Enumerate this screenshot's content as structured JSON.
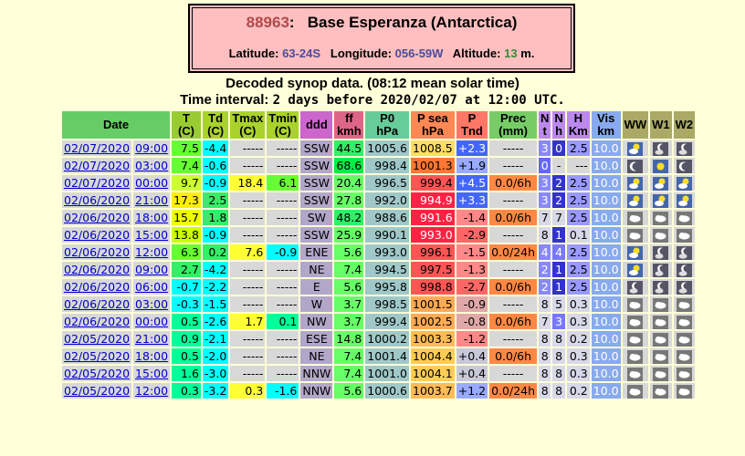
{
  "station": {
    "id": "88963",
    "name": "Base Esperanza (Antarctica)",
    "latitude_label": "Latitude:",
    "latitude": "63-24S",
    "longitude_label": "Longitude:",
    "longitude": "056-59W",
    "altitude_label": "Altitude:",
    "altitude": "13",
    "altitude_unit": "m."
  },
  "heading": {
    "line1": "Decoded synop data. (08:12 mean solar time)",
    "line2_prefix": "Time interval:",
    "line2_mono": "2 days before 2020/02/07 at 12:00 UTC."
  },
  "table": {
    "headers": [
      {
        "l1": "Date",
        "l2": ""
      },
      {
        "l1": "T",
        "l2": "(C)"
      },
      {
        "l1": "Td",
        "l2": "(C)"
      },
      {
        "l1": "Tmax",
        "l2": "(C)"
      },
      {
        "l1": "Tmin",
        "l2": "(C)"
      },
      {
        "l1": "ddd",
        "l2": ""
      },
      {
        "l1": "ff",
        "l2": "kmh"
      },
      {
        "l1": "P0",
        "l2": "hPa"
      },
      {
        "l1": "P sea",
        "l2": "hPa"
      },
      {
        "l1": "P",
        "l2": "Tnd"
      },
      {
        "l1": "Prec",
        "l2": "(mm)"
      },
      {
        "l1": "N",
        "l2": "t"
      },
      {
        "l1": "N",
        "l2": "h"
      },
      {
        "l1": "H",
        "l2": "Km"
      },
      {
        "l1": "Vis",
        "l2": "km"
      },
      {
        "l1": "WW",
        "l2": ""
      },
      {
        "l1": "W1",
        "l2": ""
      },
      {
        "l1": "W2",
        "l2": ""
      }
    ],
    "rows": [
      {
        "date": "02/07/2020",
        "time": "09:00",
        "t": "7.5",
        "td": "-4.4",
        "tmax": "-----",
        "tmin": "-----",
        "ddd": "SSW",
        "ff": "44.5",
        "p0": "1005.6",
        "psea": "1008.5",
        "ptnd": "+2.3",
        "prec": "-----",
        "nt": "3",
        "nh": "0",
        "h": "2.5",
        "vis": "10.0",
        "ww": "sun-cloud",
        "w1": "moon-cloud",
        "w2": "moon-cloud"
      },
      {
        "date": "02/07/2020",
        "time": "03:00",
        "t": "7.4",
        "td": "-0.6",
        "tmax": "-----",
        "tmin": "-----",
        "ddd": "SSW",
        "ff": "68.6",
        "p0": "998.4",
        "psea": "1001.3",
        "ptnd": "+1.9",
        "prec": "-----",
        "nt": "0",
        "nh": "-",
        "h": "---",
        "vis": "10.0",
        "ww": "moon",
        "w1": "sun",
        "w2": "moon"
      },
      {
        "date": "02/07/2020",
        "time": "00:00",
        "t": "9.7",
        "td": "-0.9",
        "tmax": "18.4",
        "tmin": "6.1",
        "ddd": "SSW",
        "ff": "20.4",
        "p0": "996.5",
        "psea": "999.4",
        "ptnd": "+4.5",
        "prec": "0.0/6h",
        "nt": "3",
        "nh": "2",
        "h": "2.5",
        "vis": "10.0",
        "ww": "sun-cloud",
        "w1": "sun-cloud",
        "w2": "sun-cloud"
      },
      {
        "date": "02/06/2020",
        "time": "21:00",
        "t": "17.3",
        "td": "2.5",
        "tmax": "-----",
        "tmin": "-----",
        "ddd": "SSW",
        "ff": "27.8",
        "p0": "992.0",
        "psea": "994.9",
        "ptnd": "+3.3",
        "prec": "-----",
        "nt": "3",
        "nh": "2",
        "h": "2.5",
        "vis": "10.0",
        "ww": "sun-cloud",
        "w1": "sun-cloud",
        "w2": "sun-cloud"
      },
      {
        "date": "02/06/2020",
        "time": "18:00",
        "t": "15.7",
        "td": "1.8",
        "tmax": "-----",
        "tmin": "-----",
        "ddd": "SW",
        "ff": "48.2",
        "p0": "988.6",
        "psea": "991.6",
        "ptnd": "-1.4",
        "prec": "0.0/6h",
        "nt": "7",
        "nh": "7",
        "h": "2.5",
        "vis": "10.0",
        "ww": "cloud",
        "w1": "cloud",
        "w2": "cloud"
      },
      {
        "date": "02/06/2020",
        "time": "15:00",
        "t": "13.8",
        "td": "-0.9",
        "tmax": "-----",
        "tmin": "-----",
        "ddd": "SSW",
        "ff": "25.9",
        "p0": "990.1",
        "psea": "993.0",
        "ptnd": "-2.9",
        "prec": "-----",
        "nt": "8",
        "nh": "1",
        "h": "0.1",
        "vis": "10.0",
        "ww": "cloud",
        "w1": "cloud",
        "w2": "cloud"
      },
      {
        "date": "02/06/2020",
        "time": "12:00",
        "t": "6.3",
        "td": "0.2",
        "tmax": "7.6",
        "tmin": "-0.9",
        "ddd": "ENE",
        "ff": "5.6",
        "p0": "993.0",
        "psea": "996.1",
        "ptnd": "-1.5",
        "prec": "0.0/24h",
        "nt": "4",
        "nh": "4",
        "h": "2.5",
        "vis": "10.0",
        "ww": "sun-cloud",
        "w1": "moon-cloud",
        "w2": "moon-cloud"
      },
      {
        "date": "02/06/2020",
        "time": "09:00",
        "t": "2.7",
        "td": "-4.2",
        "tmax": "-----",
        "tmin": "-----",
        "ddd": "NE",
        "ff": "7.4",
        "p0": "994.5",
        "psea": "997.5",
        "ptnd": "-1.3",
        "prec": "-----",
        "nt": "2",
        "nh": "1",
        "h": "2.5",
        "vis": "10.0",
        "ww": "sun-cloud",
        "w1": "moon-cloud",
        "w2": "moon-cloud"
      },
      {
        "date": "02/06/2020",
        "time": "06:00",
        "t": "-0.7",
        "td": "-2.2",
        "tmax": "-----",
        "tmin": "-----",
        "ddd": "E",
        "ff": "5.6",
        "p0": "995.8",
        "psea": "998.8",
        "ptnd": "-2.7",
        "prec": "0.0/6h",
        "nt": "2",
        "nh": "1",
        "h": "2.5",
        "vis": "10.0",
        "ww": "moon-cloud",
        "w1": "moon-cloud",
        "w2": "moon-cloud"
      },
      {
        "date": "02/06/2020",
        "time": "03:00",
        "t": "-0.3",
        "td": "-1.5",
        "tmax": "-----",
        "tmin": "-----",
        "ddd": "W",
        "ff": "3.7",
        "p0": "998.5",
        "psea": "1001.5",
        "ptnd": "-0.9",
        "prec": "-----",
        "nt": "8",
        "nh": "5",
        "h": "0.3",
        "vis": "10.0",
        "ww": "cloud",
        "w1": "cloud",
        "w2": "cloud"
      },
      {
        "date": "02/06/2020",
        "time": "00:00",
        "t": "0.5",
        "td": "-2.6",
        "tmax": "1.7",
        "tmin": "0.1",
        "ddd": "NW",
        "ff": "3.7",
        "p0": "999.4",
        "psea": "1002.5",
        "ptnd": "-0.8",
        "prec": "0.0/6h",
        "nt": "7",
        "nh": "3",
        "h": "0.3",
        "vis": "10.0",
        "ww": "cloud",
        "w1": "cloud",
        "w2": "cloud"
      },
      {
        "date": "02/05/2020",
        "time": "21:00",
        "t": "0.9",
        "td": "-2.1",
        "tmax": "-----",
        "tmin": "-----",
        "ddd": "ESE",
        "ff": "14.8",
        "p0": "1000.2",
        "psea": "1003.3",
        "ptnd": "-1.2",
        "prec": "-----",
        "nt": "8",
        "nh": "8",
        "h": "0.2",
        "vis": "10.0",
        "ww": "cloud",
        "w1": "cloud",
        "w2": "cloud"
      },
      {
        "date": "02/05/2020",
        "time": "18:00",
        "t": "0.5",
        "td": "-2.0",
        "tmax": "-----",
        "tmin": "-----",
        "ddd": "NE",
        "ff": "7.4",
        "p0": "1001.4",
        "psea": "1004.4",
        "ptnd": "+0.4",
        "prec": "0.0/6h",
        "nt": "8",
        "nh": "8",
        "h": "0.3",
        "vis": "10.0",
        "ww": "cloud",
        "w1": "cloud",
        "w2": "cloud"
      },
      {
        "date": "02/05/2020",
        "time": "15:00",
        "t": "1.6",
        "td": "-3.0",
        "tmax": "-----",
        "tmin": "-----",
        "ddd": "NNW",
        "ff": "7.4",
        "p0": "1001.0",
        "psea": "1004.1",
        "ptnd": "+0.4",
        "prec": "-----",
        "nt": "8",
        "nh": "8",
        "h": "0.3",
        "vis": "10.0",
        "ww": "cloud",
        "w1": "cloud",
        "w2": "cloud"
      },
      {
        "date": "02/05/2020",
        "time": "12:00",
        "t": "0.3",
        "td": "-3.2",
        "tmax": "0.3",
        "tmin": "-1.6",
        "ddd": "NNW",
        "ff": "5.6",
        "p0": "1000.6",
        "psea": "1003.7",
        "ptnd": "+1.2",
        "prec": "0.0/24h",
        "nt": "8",
        "nh": "8",
        "h": "0.2",
        "vis": "10.0",
        "ww": "cloud",
        "w1": "cloud",
        "w2": "cloud"
      }
    ]
  },
  "colors": {
    "header_date": "#66cc66",
    "header_t": "#99cc33",
    "header_td": "#aad22d",
    "header_tmax": "#aad22d",
    "header_tmin": "#aad22d",
    "header_ddd": "#cc66cc",
    "header_ff": "#dd6688",
    "header_p0": "#66cc99",
    "header_psea": "#ff8855",
    "header_ptnd": "#ff7766",
    "header_prec": "#77cc66",
    "header_nt": "#bb88ee",
    "header_nh": "#bb88ee",
    "header_h": "#bb88ee",
    "header_vis": "#88aaee",
    "header_wx": "#aaaa66",
    "ddd_bg": "#b0a8c8",
    "ff_bg": "#80ff80",
    "p0_bg": "#a0c8c8",
    "vis_bg": "#88aaee",
    "h_bg": "#9999ff"
  }
}
